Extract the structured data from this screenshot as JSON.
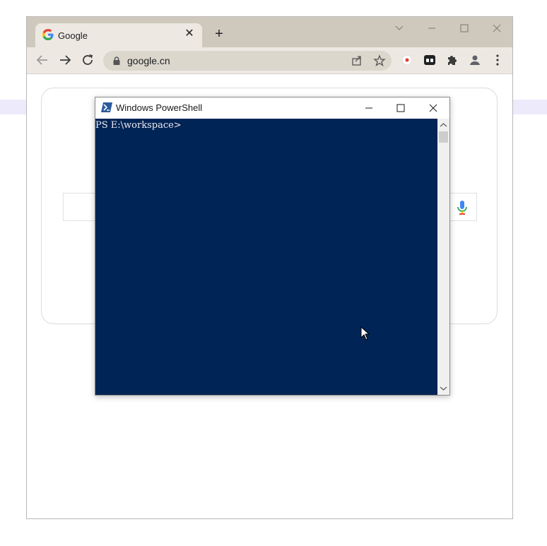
{
  "browser": {
    "tab": {
      "title": "Google",
      "favicon": "google-g-icon"
    },
    "new_tab": "+",
    "address": {
      "url": "google.cn"
    },
    "icons": [
      "back-icon",
      "forward-icon",
      "reload-icon",
      "lock-icon",
      "share-icon",
      "star-icon",
      "record-icon",
      "extension-icon",
      "puzzle-icon",
      "profile-icon",
      "menu-icon"
    ]
  },
  "powershell": {
    "title": "Windows PowerShell",
    "prompt": "PS E:\\workspace>",
    "colors": {
      "console_bg": "#012456",
      "text": "#eeedf0"
    }
  },
  "colors": {
    "chrome_frame": "#cfc9bd",
    "chrome_toolbar": "#ede9e2",
    "omnibox": "#dcd7cd"
  }
}
